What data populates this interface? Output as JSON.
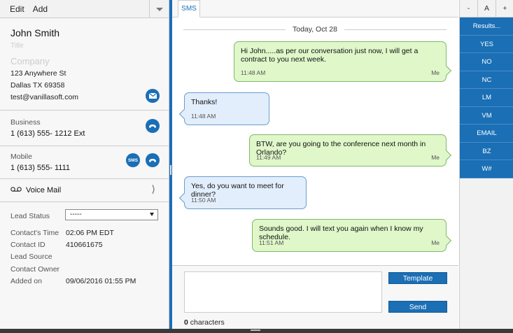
{
  "toolbar": {
    "edit_label": "Edit",
    "add_label": "Add"
  },
  "contact": {
    "name": "John Smith",
    "title_placeholder": "Title",
    "company_placeholder": "Company",
    "address": "123 Anywhere St",
    "city_line": "Dallas  TX  69358",
    "email": "test@vanillasoft.com"
  },
  "phones": {
    "business": {
      "label": "Business",
      "number": "1 (613) 555- 1212   Ext"
    },
    "mobile": {
      "label": "Mobile",
      "number": "1 (613) 555- 1111",
      "sms_label": "SMS"
    }
  },
  "voicemail": {
    "label": "Voice Mail",
    "chevron": "⟩"
  },
  "lead": {
    "status_label": "Lead Status",
    "status_value": "-----",
    "fields": [
      {
        "label": "Contact's Time",
        "value": "02:06 PM EDT"
      },
      {
        "label": "Contact ID",
        "value": "410661675"
      },
      {
        "label": "Lead Source",
        "value": ""
      },
      {
        "label": "Contact Owner",
        "value": ""
      },
      {
        "label": "Added on",
        "value": "09/06/2016 01:55 PM"
      }
    ]
  },
  "sms": {
    "tab_label": "SMS",
    "date_header": "Today, Oct 28",
    "messages": [
      {
        "direction": "out",
        "text": "Hi John.....as per our conversation just now, I will get a contract to you next week.",
        "time": "11:48 AM",
        "sender": "Me"
      },
      {
        "direction": "in",
        "text": "Thanks!",
        "time": "11:48 AM"
      },
      {
        "direction": "out",
        "text": "BTW, are you going to the conference next month in Orlando?",
        "time": "11:49 AM",
        "sender": "Me"
      },
      {
        "direction": "in",
        "text": "Yes, do you want to meet for dinner?",
        "time": "11:50 AM"
      },
      {
        "direction": "out",
        "text": "Sounds good. I will text you again when I know my schedule.",
        "time": "11:51 AM",
        "sender": "Me"
      }
    ],
    "template_label": "Template",
    "send_label": "Send",
    "char_count": "0",
    "char_suffix": " characters"
  },
  "zoom": {
    "minus": "-",
    "font": "A",
    "plus": "+"
  },
  "results": {
    "header": "Results...",
    "items": [
      "YES",
      "NO",
      "NC",
      "LM",
      "VM",
      "EMAIL",
      "BZ",
      "W#"
    ]
  },
  "colors": {
    "accent": "#1a6fb5",
    "outgoing_bubble": "#dff7c9",
    "incoming_bubble": "#e2eefb"
  }
}
